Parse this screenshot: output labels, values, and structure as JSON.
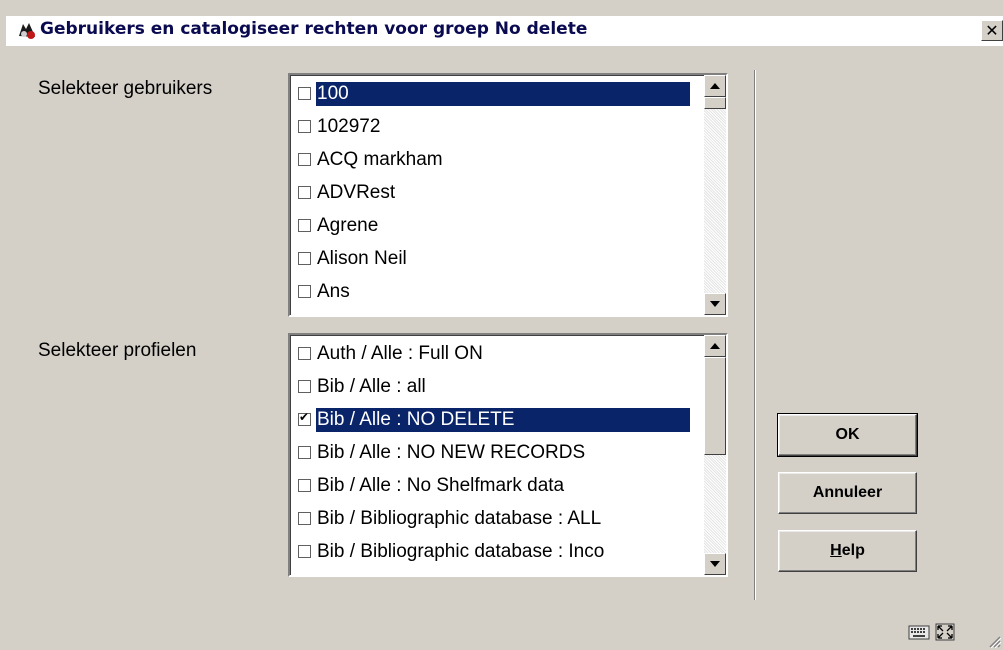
{
  "window": {
    "title": "Gebruikers en catalogiseer rechten voor groep No delete",
    "close_glyph": "✕",
    "icon": "app-logo-icon"
  },
  "users": {
    "label": "Selekteer gebruikers",
    "items": [
      {
        "label": "100",
        "checked": false,
        "selected": true
      },
      {
        "label": "102972",
        "checked": false,
        "selected": false
      },
      {
        "label": "ACQ markham",
        "checked": false,
        "selected": false
      },
      {
        "label": "ADVRest",
        "checked": false,
        "selected": false
      },
      {
        "label": "Agrene",
        "checked": false,
        "selected": false
      },
      {
        "label": "Alison Neil",
        "checked": false,
        "selected": false
      },
      {
        "label": "Ans",
        "checked": false,
        "selected": false
      }
    ]
  },
  "profiles": {
    "label": "Selekteer profielen",
    "items": [
      {
        "label": "Auth / Alle : Full ON",
        "checked": false,
        "selected": false
      },
      {
        "label": "Bib / Alle : all",
        "checked": false,
        "selected": false
      },
      {
        "label": "Bib / Alle : NO DELETE",
        "checked": true,
        "selected": true
      },
      {
        "label": "Bib / Alle : NO NEW RECORDS",
        "checked": false,
        "selected": false
      },
      {
        "label": "Bib / Alle : No Shelfmark data",
        "checked": false,
        "selected": false
      },
      {
        "label": "Bib / Bibliographic database : ALL",
        "checked": false,
        "selected": false
      },
      {
        "label": "Bib / Bibliographic database : Inco",
        "checked": false,
        "selected": false
      }
    ]
  },
  "buttons": {
    "ok": "OK",
    "cancel": "Annuleer",
    "help_prefix": "H",
    "help_rest": "elp"
  },
  "status_icons": [
    "keyboard-icon",
    "resize-icon",
    "size-grip-icon"
  ],
  "colors": {
    "selection": "#0a246a",
    "face": "#d4d0c8"
  }
}
